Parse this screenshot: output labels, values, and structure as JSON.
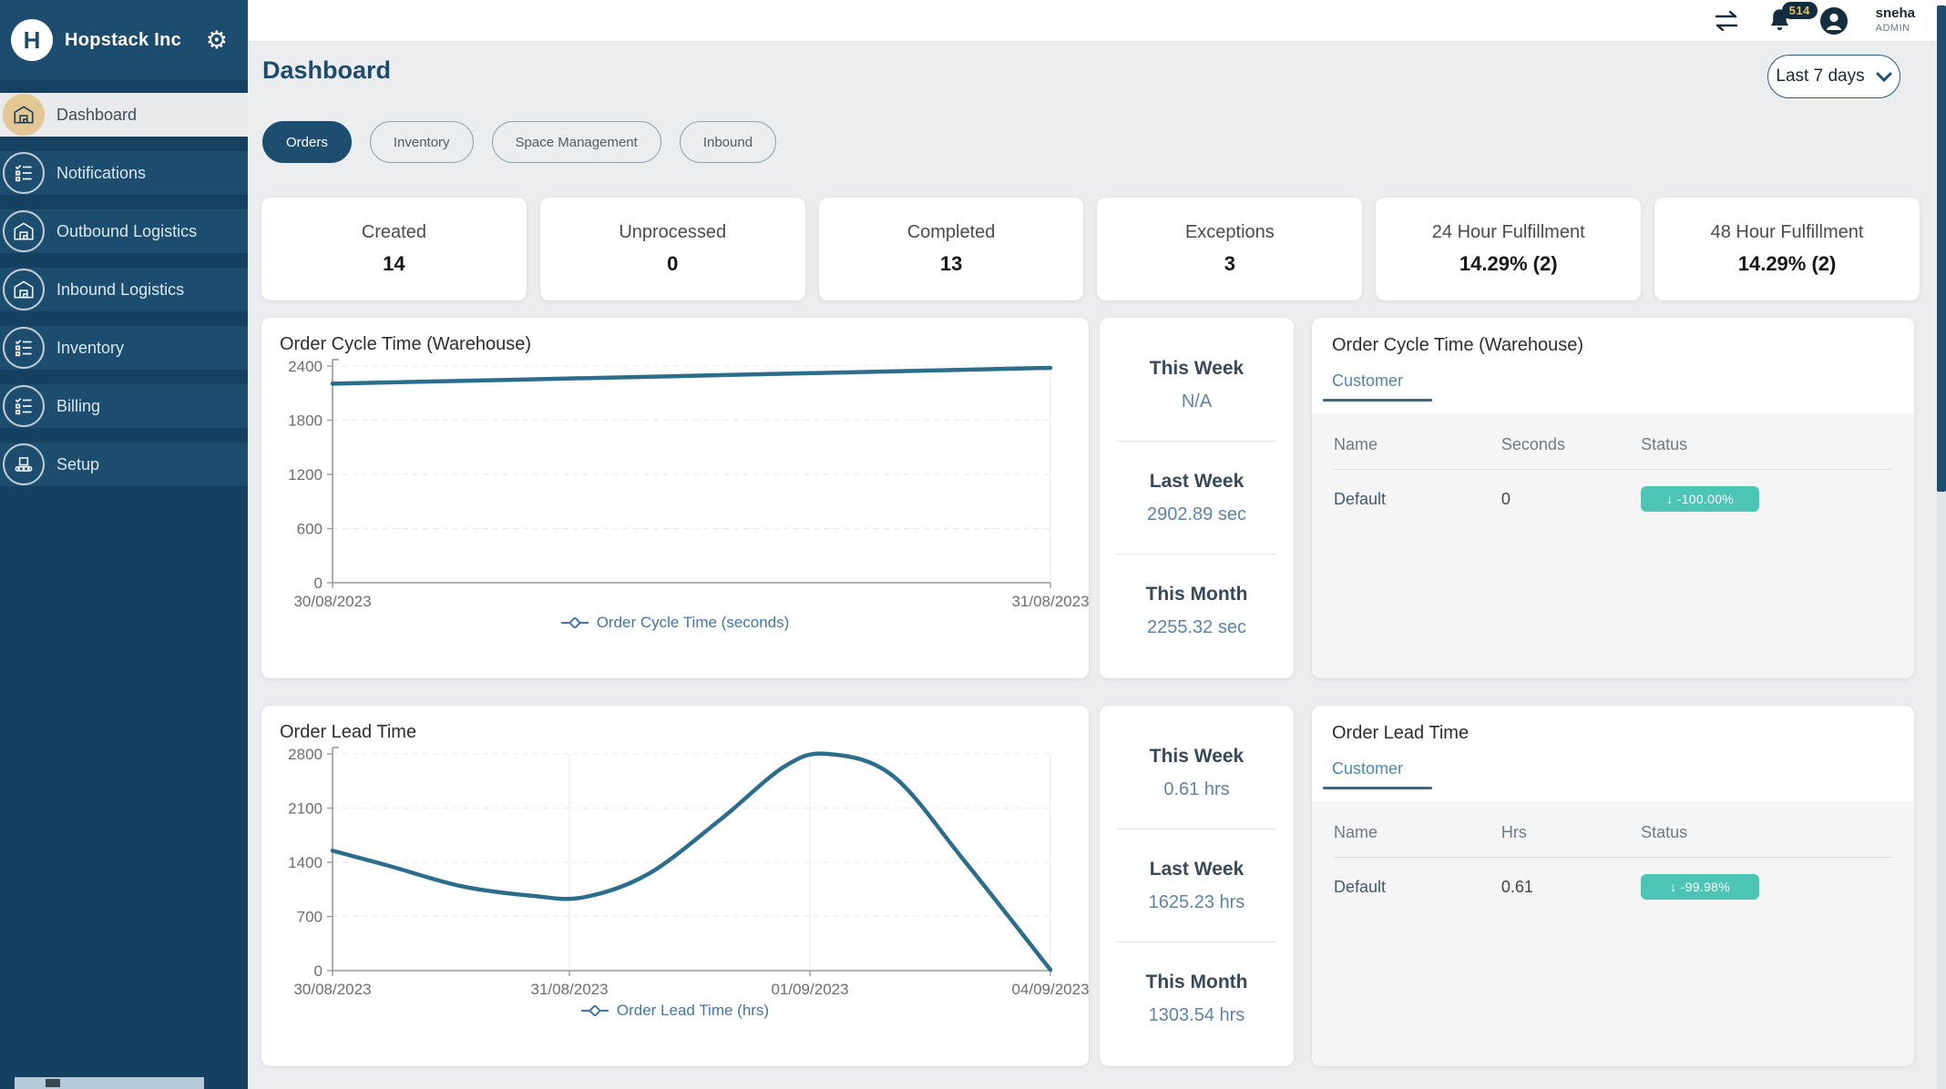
{
  "sidebar": {
    "brand": "Hopstack Inc",
    "logo_letter": "H",
    "items": [
      {
        "label": "Dashboard",
        "icon": "warehouse-icon",
        "active": true
      },
      {
        "label": "Notifications",
        "icon": "checklist-icon",
        "active": false
      },
      {
        "label": "Outbound Logistics",
        "icon": "warehouse-icon",
        "active": false
      },
      {
        "label": "Inbound Logistics",
        "icon": "warehouse-icon",
        "active": false
      },
      {
        "label": "Inventory",
        "icon": "checklist-icon",
        "active": false
      },
      {
        "label": "Billing",
        "icon": "checklist-icon",
        "active": false
      },
      {
        "label": "Setup",
        "icon": "conveyor-icon",
        "active": false
      }
    ]
  },
  "topbar": {
    "notification_count": "514",
    "user_name": "sneha",
    "user_role": "ADMIN"
  },
  "header": {
    "title": "Dashboard",
    "date_range": "Last 7 days"
  },
  "filters": [
    {
      "label": "Orders",
      "active": true
    },
    {
      "label": "Inventory",
      "active": false
    },
    {
      "label": "Space Management",
      "active": false
    },
    {
      "label": "Inbound",
      "active": false
    }
  ],
  "stats": [
    {
      "label": "Created",
      "value": "14"
    },
    {
      "label": "Unprocessed",
      "value": "0"
    },
    {
      "label": "Completed",
      "value": "13"
    },
    {
      "label": "Exceptions",
      "value": "3"
    },
    {
      "label": "24 Hour Fulfillment",
      "value": "14.29% (2)"
    },
    {
      "label": "48 Hour Fulfillment",
      "value": "14.29% (2)"
    }
  ],
  "panels": [
    {
      "rows": [
        {
          "label": "This Week",
          "value": "N/A"
        },
        {
          "label": "Last Week",
          "value": "2902.89 sec"
        },
        {
          "label": "This Month",
          "value": "2255.32 sec"
        }
      ]
    },
    {
      "rows": [
        {
          "label": "This Week",
          "value": "0.61 hrs"
        },
        {
          "label": "Last Week",
          "value": "1625.23 hrs"
        },
        {
          "label": "This Month",
          "value": "1303.54 hrs"
        }
      ]
    }
  ],
  "tables": [
    {
      "title": "Order Cycle Time (Warehouse)",
      "tab": "Customer",
      "columns": [
        "Name",
        "Seconds",
        "Status"
      ],
      "rows": [
        {
          "name": "Default",
          "value": "0",
          "status": "↓ -100.00%"
        }
      ]
    },
    {
      "title": "Order Lead Time",
      "tab": "Customer",
      "columns": [
        "Name",
        "Hrs",
        "Status"
      ],
      "rows": [
        {
          "name": "Default",
          "value": "0.61",
          "status": "↓ -99.98%"
        }
      ]
    }
  ],
  "chart_data": [
    {
      "type": "line",
      "title": "Order Cycle Time (Warehouse)",
      "legend": "Order Cycle Time (seconds)",
      "ylabel": "seconds",
      "ylim": [
        0,
        2400
      ],
      "yticks": [
        0,
        600,
        1200,
        1800,
        2400
      ],
      "xticks": [
        {
          "label": "30/08/2023",
          "f": 0
        },
        {
          "label": "31/08/2023",
          "f": 1
        }
      ],
      "points": [
        [
          0,
          2205
        ],
        [
          0.25,
          2248
        ],
        [
          0.5,
          2292
        ],
        [
          0.75,
          2336
        ],
        [
          1,
          2380
        ]
      ],
      "line_color": "#2c6d8c"
    },
    {
      "type": "line",
      "title": "Order Lead Time",
      "legend": "Order Lead Time (hrs)",
      "ylabel": "hrs",
      "ylim": [
        0,
        2800
      ],
      "yticks": [
        0,
        700,
        1400,
        2100,
        2800
      ],
      "xticks": [
        {
          "label": "30/08/2023",
          "f": 0
        },
        {
          "label": "31/08/2023",
          "f": 0.33
        },
        {
          "label": "01/09/2023",
          "f": 0.665
        },
        {
          "label": "04/09/2023",
          "f": 1
        }
      ],
      "points": [
        [
          0,
          1550
        ],
        [
          0.08,
          1350
        ],
        [
          0.18,
          1090
        ],
        [
          0.28,
          965
        ],
        [
          0.35,
          948
        ],
        [
          0.44,
          1250
        ],
        [
          0.54,
          1950
        ],
        [
          0.63,
          2640
        ],
        [
          0.69,
          2800
        ],
        [
          0.78,
          2520
        ],
        [
          0.88,
          1420
        ],
        [
          1,
          10
        ]
      ],
      "line_color": "#2c6d8c"
    }
  ],
  "icons": [
    "settings-gear-icon",
    "warehouse-icon",
    "checklist-icon",
    "conveyor-icon",
    "transfer-arrows-icon",
    "bell-icon",
    "avatar-icon",
    "chevron-down-icon",
    "down-arrow"
  ],
  "colors": {
    "accent": "#1d4e6f",
    "sidebar": "#1d4d6e",
    "badge_teal": "#4cc4b6",
    "chart_line": "#2c6d8c",
    "legend_blue": "#4376a0",
    "active_icon_circle": "#e3c795"
  }
}
